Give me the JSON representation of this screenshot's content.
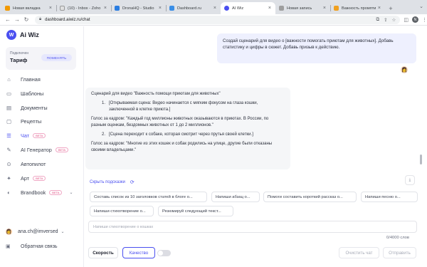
{
  "browser": {
    "tabs": [
      {
        "title": "Новая вкладка",
        "favicon_color": "#f29900"
      },
      {
        "title": "(10) - Inbox - Zoho",
        "favicon_color": "#e0e0e0"
      },
      {
        "title": "DronaHQ - Studio",
        "favicon_color": "#2a7de1"
      },
      {
        "title": "Dashboard.ru",
        "favicon_color": "#3a8ee6"
      },
      {
        "title": "AI Wiz",
        "favicon_color": "#4a4ff0"
      },
      {
        "title": "Новая запись",
        "favicon_color": "#9e9e9e"
      },
      {
        "title": "Важность промпти",
        "favicon_color": "#f0a020"
      }
    ],
    "url": "dashboard.aiwiz.ru/chat",
    "profile_initial": "N"
  },
  "sidebar": {
    "logo_text": "Ai Wiz",
    "logo_mark": "W",
    "plan": {
      "label": "Подключен",
      "name": "Тариф",
      "button": "ПОМЕНЯТЬ"
    },
    "items": [
      {
        "label": "Главная",
        "icon": "home-icon",
        "glyph": "⌂"
      },
      {
        "label": "Шаблоны",
        "icon": "templates-icon",
        "glyph": "▭"
      },
      {
        "label": "Документы",
        "icon": "documents-icon",
        "glyph": "▤"
      },
      {
        "label": "Рецепты",
        "icon": "recipes-icon",
        "glyph": "▢"
      },
      {
        "label": "Чат",
        "icon": "chat-icon",
        "glyph": "☰",
        "badge": "BETA"
      },
      {
        "label": "AI Генератор",
        "icon": "ai-generator-icon",
        "glyph": "✎",
        "badge": "BETA"
      },
      {
        "label": "Автопилот",
        "icon": "autopilot-icon",
        "glyph": "⊙"
      },
      {
        "label": "Арт",
        "icon": "art-icon",
        "glyph": "✦",
        "badge": "BETA"
      },
      {
        "label": "Brandbook",
        "icon": "brandbook-icon",
        "glyph": "◐",
        "badge": "BETA"
      }
    ],
    "user": "ana.ch@imversed",
    "feedback": "Обратная связь"
  },
  "chat": {
    "user_message": "Создай сценарий для видео о [важности помогать приютам для животных]. Добавь статистику и цифры в сюжет. Добавь призыв к действию.",
    "assistant": {
      "intro": "Сценарий для видео \"Важность помощи приютам для животных\"",
      "step1_num": "1.",
      "step1": "[Открываемая сцена: Видео начинается с мягким фокусом на глаза кошки, заключенной в клетке приюта.]",
      "voice1": "Голос за кадром: \"Каждый год миллионы животных оказываются в приютах. В России, по разным оценкам, бездомных животных от 1 до 2 миллионов.\"",
      "step2_num": "2.",
      "step2": "[Сцена переходит к собаке, которая смотрит через прутья своей клетки.]",
      "voice2": "Голос за кадром: \"Многие из этих кошек и собак родились на улице, другие были отказаны своими владельцами.\""
    },
    "hide_hints": "Скрыть подсказки",
    "suggestions": [
      "Составь список из 10 заголовков статей в блоге о...",
      "Напиши абзац о...",
      "Помоги составить короткий рассказ о...",
      "Напиши песню о...",
      "Напиши стихотворение о...",
      "Резюмируй следующий текст..."
    ],
    "input_placeholder": "Напиши стихотворение о кошках",
    "counter": "0/4000 слов",
    "mode_speed": "Скорость",
    "mode_quality": "Качество",
    "clear_chat": "Очистить чат",
    "send": "Отправить"
  },
  "colors": {
    "accent": "#4a4ff0",
    "badge": "#e0457b"
  }
}
